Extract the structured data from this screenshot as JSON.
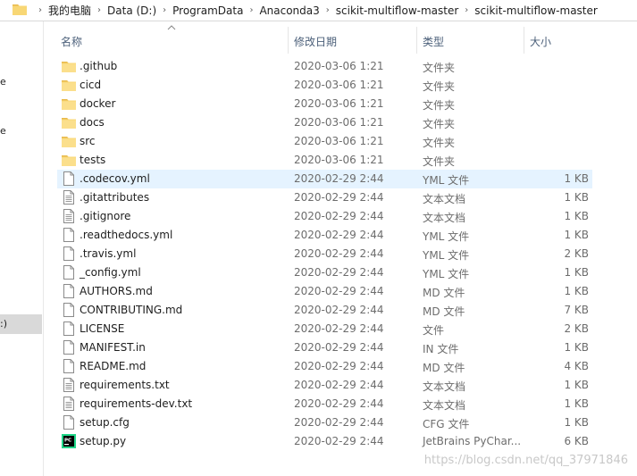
{
  "breadcrumb": [
    "我的电脑",
    "Data (D:)",
    "ProgramData",
    "Anaconda3",
    "scikit-multiflow-master",
    "scikit-multiflow-master"
  ],
  "columns": {
    "name": "名称",
    "date": "修改日期",
    "type": "类型",
    "size": "大小"
  },
  "nav_fragments": [
    "e",
    "e",
    ":)"
  ],
  "files": [
    {
      "name": ".github",
      "date": "2020-03-06 1:21",
      "type": "文件夹",
      "size": "",
      "icon": "folder-icon"
    },
    {
      "name": "cicd",
      "date": "2020-03-06 1:21",
      "type": "文件夹",
      "size": "",
      "icon": "folder-icon"
    },
    {
      "name": "docker",
      "date": "2020-03-06 1:21",
      "type": "文件夹",
      "size": "",
      "icon": "folder-icon"
    },
    {
      "name": "docs",
      "date": "2020-03-06 1:21",
      "type": "文件夹",
      "size": "",
      "icon": "folder-icon"
    },
    {
      "name": "src",
      "date": "2020-03-06 1:21",
      "type": "文件夹",
      "size": "",
      "icon": "folder-icon"
    },
    {
      "name": "tests",
      "date": "2020-03-06 1:21",
      "type": "文件夹",
      "size": "",
      "icon": "folder-icon"
    },
    {
      "name": ".codecov.yml",
      "date": "2020-02-29 2:44",
      "type": "YML 文件",
      "size": "1 KB",
      "icon": "file-icon",
      "highlight": true
    },
    {
      "name": ".gitattributes",
      "date": "2020-02-29 2:44",
      "type": "文本文档",
      "size": "1 KB",
      "icon": "text-file-icon"
    },
    {
      "name": ".gitignore",
      "date": "2020-02-29 2:44",
      "type": "文本文档",
      "size": "1 KB",
      "icon": "text-file-icon"
    },
    {
      "name": ".readthedocs.yml",
      "date": "2020-02-29 2:44",
      "type": "YML 文件",
      "size": "1 KB",
      "icon": "file-icon"
    },
    {
      "name": ".travis.yml",
      "date": "2020-02-29 2:44",
      "type": "YML 文件",
      "size": "2 KB",
      "icon": "file-icon"
    },
    {
      "name": "_config.yml",
      "date": "2020-02-29 2:44",
      "type": "YML 文件",
      "size": "1 KB",
      "icon": "file-icon"
    },
    {
      "name": "AUTHORS.md",
      "date": "2020-02-29 2:44",
      "type": "MD 文件",
      "size": "1 KB",
      "icon": "file-icon"
    },
    {
      "name": "CONTRIBUTING.md",
      "date": "2020-02-29 2:44",
      "type": "MD 文件",
      "size": "7 KB",
      "icon": "file-icon"
    },
    {
      "name": "LICENSE",
      "date": "2020-02-29 2:44",
      "type": "文件",
      "size": "2 KB",
      "icon": "file-icon"
    },
    {
      "name": "MANIFEST.in",
      "date": "2020-02-29 2:44",
      "type": "IN 文件",
      "size": "1 KB",
      "icon": "file-icon"
    },
    {
      "name": "README.md",
      "date": "2020-02-29 2:44",
      "type": "MD 文件",
      "size": "4 KB",
      "icon": "file-icon"
    },
    {
      "name": "requirements.txt",
      "date": "2020-02-29 2:44",
      "type": "文本文档",
      "size": "1 KB",
      "icon": "text-file-icon"
    },
    {
      "name": "requirements-dev.txt",
      "date": "2020-02-29 2:44",
      "type": "文本文档",
      "size": "1 KB",
      "icon": "text-file-icon"
    },
    {
      "name": "setup.cfg",
      "date": "2020-02-29 2:44",
      "type": "CFG 文件",
      "size": "1 KB",
      "icon": "file-icon"
    },
    {
      "name": "setup.py",
      "date": "2020-02-29 2:44",
      "type": "JetBrains PyChar...",
      "size": "6 KB",
      "icon": "pycharm-icon"
    }
  ],
  "watermark": "https://blog.csdn.net/qq_37971846",
  "colors": {
    "folder": "#f8d775",
    "hover_row": "#e5f3ff",
    "header_text": "#4c607a",
    "nav_selected": "#d9d9d9"
  }
}
